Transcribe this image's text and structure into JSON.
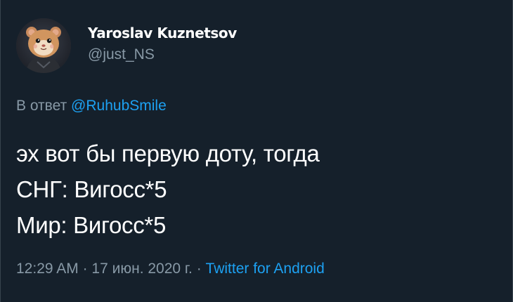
{
  "author": {
    "display_name": "Yaroslav Kuznetsov",
    "handle": "@just_NS",
    "avatar_icon": "hamster-avatar"
  },
  "reply": {
    "prefix": "В ответ",
    "mention": "@RuhubSmile"
  },
  "tweet": {
    "lines": [
      "эх вот бы первую доту, тогда",
      "СНГ: Вигосс*5",
      "Мир: Вигосс*5"
    ]
  },
  "meta": {
    "time": "12:29 AM",
    "separator": "·",
    "date": "17 июн. 2020 г.",
    "source": "Twitter for Android"
  },
  "colors": {
    "background": "#15202b",
    "text": "#ffffff",
    "secondary": "#8899a6",
    "link": "#1da1f2"
  }
}
